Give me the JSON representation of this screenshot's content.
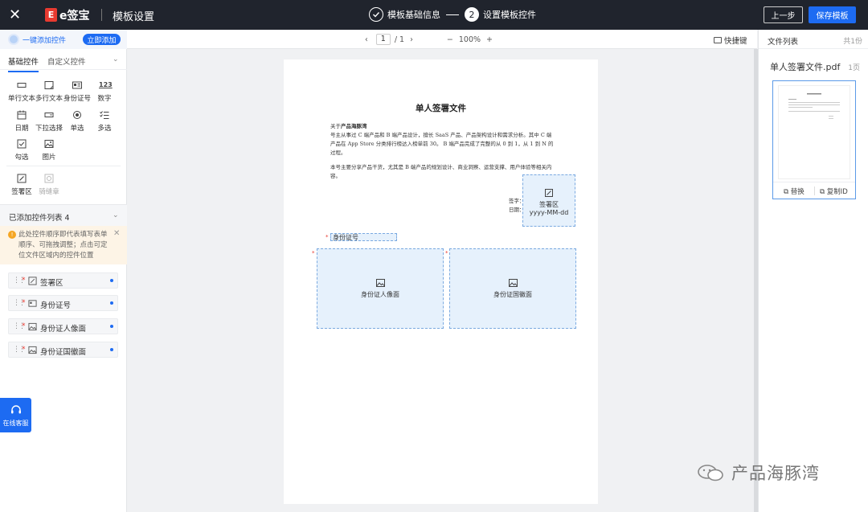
{
  "topbar": {
    "close_icon": "close-icon",
    "logo_mark": "E",
    "logo_text": "e签宝",
    "title": "模板设置",
    "steps": [
      {
        "label": "模板基础信息",
        "state": "done"
      },
      {
        "number": "2",
        "label": "设置模板控件",
        "state": "active"
      }
    ],
    "prev_label": "上一步",
    "save_label": "保存模板",
    "accent": "#1d6bf2"
  },
  "left": {
    "quick_add_label": "一键添加控件",
    "quick_add_button": "立即添加",
    "tabs": [
      "基础控件",
      "自定义控件"
    ],
    "controls": [
      {
        "label": "单行文本",
        "icon": "single-line-text-icon"
      },
      {
        "label": "多行文本",
        "icon": "multi-line-text-icon"
      },
      {
        "label": "身份证号",
        "icon": "id-card-icon"
      },
      {
        "label": "数字",
        "icon": "number-icon",
        "glyph": "123"
      },
      {
        "label": "日期",
        "icon": "calendar-icon"
      },
      {
        "label": "下拉选择",
        "icon": "dropdown-icon"
      },
      {
        "label": "单选",
        "icon": "radio-icon"
      },
      {
        "label": "多选",
        "icon": "checklist-icon"
      },
      {
        "label": "勾选",
        "icon": "checkbox-icon"
      },
      {
        "label": "图片",
        "icon": "image-icon"
      },
      {
        "label": "签署区",
        "icon": "signature-icon"
      },
      {
        "label": "骑缝章",
        "icon": "seal-icon",
        "disabled": true
      }
    ],
    "added_title": "已添加控件列表 4",
    "notice": "此处控件顺序即代表填写表单顺序、可拖拽调整；点击可定位文件区域内的控件位置",
    "added_items": [
      {
        "label": "签署区",
        "icon": "signature-icon"
      },
      {
        "label": "身份证号",
        "icon": "id-card-icon"
      },
      {
        "label": "身份证人像面",
        "icon": "image-icon"
      },
      {
        "label": "身份证国徽面",
        "icon": "image-icon"
      }
    ],
    "customer_service": "在线客服"
  },
  "toolbar": {
    "page_current": "1",
    "page_total": "/ 1",
    "zoom": "100%",
    "shortcut": "快捷键"
  },
  "document": {
    "title": "单人签署文件",
    "para1_prefix": "关于",
    "para1_bold": "产品海豚湾",
    "para1_rest": "号主从事过 C 端产品和 B 端产品设计，擅长 SaaS 产品、产品架构设计和需求分析。其中 C 端产品在 App Store 分类排行榜达入榜单前 30。 B 端产品完成了完整的从 0 到 1，从 1 到 N 的过程。",
    "para2": "本号主要分享产品干货，尤其是 B 端产品的规划设计、商业洞察、运营支撑、用户体验等相关内容。",
    "sign_label": "签字：",
    "date_label": "日期：",
    "sig_field_label": "签署区",
    "sig_field_format": "yyyy-MM-dd",
    "id_field_label": "身份证号",
    "photo_front": "身份证人像面",
    "photo_back": "身份证国徽面"
  },
  "right": {
    "title": "文件列表",
    "count": "共1份",
    "file_name": "单人签署文件.pdf",
    "file_pages": "1页",
    "replace": "替换",
    "copy_id": "复制ID"
  },
  "watermark": {
    "text": "产品海豚湾"
  }
}
